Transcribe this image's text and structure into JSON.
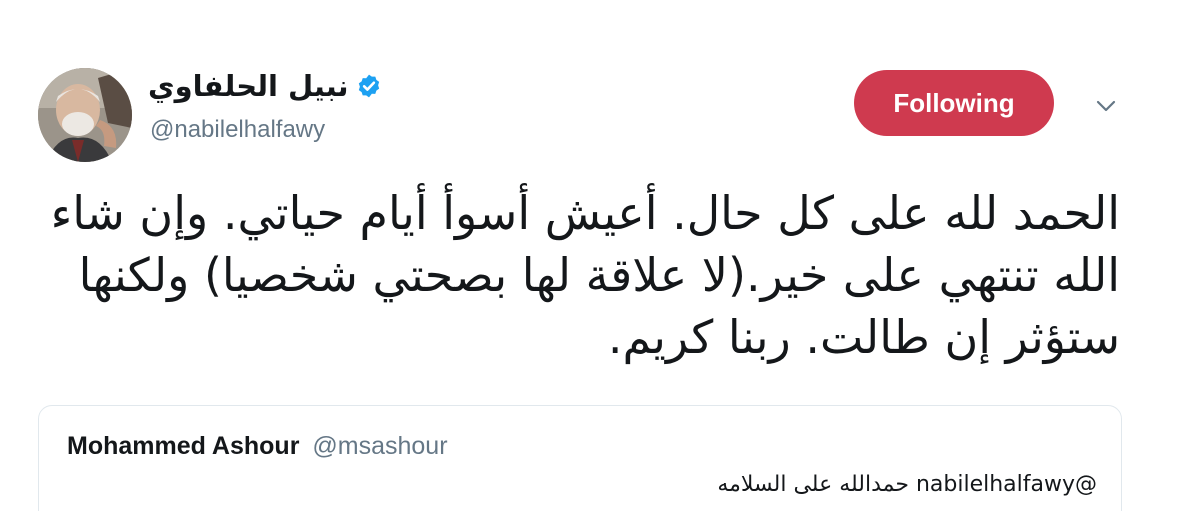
{
  "tweet": {
    "author": {
      "display_name": "نبيل الحلفاوي",
      "handle": "@nabilelhalfawy",
      "verified": true
    },
    "follow_button_label": "Following",
    "text": "الحمد لله على كل حال. أعيش أسوأ أيام حياتي. وإن شاء الله تنتهي على خير.(لا علاقة لها بصحتي شخصيا) ولكنها ستؤثر إن طالت. ربنا كريم.",
    "quoted_tweet": {
      "author_name": "Mohammed Ashour",
      "author_handle": "@msashour",
      "text": "@nabilelhalfawy حمدالله على السلامه"
    }
  },
  "colors": {
    "follow_button_bg": "#cf3a4f",
    "verified_badge": "#1da1f2",
    "secondary_text": "#657786",
    "card_border": "#e1e8ed"
  },
  "icons": {
    "verified": "verified-badge-icon",
    "menu": "chevron-down-icon"
  }
}
